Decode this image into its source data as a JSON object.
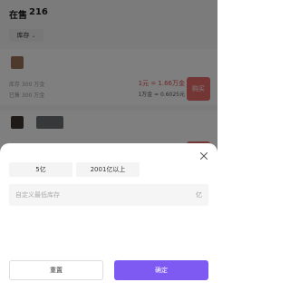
{
  "header": {
    "title_prefix": "在售",
    "title_count": "216"
  },
  "filter": {
    "stock_label": "库存",
    "chevron": "⌄"
  },
  "listing1": {
    "stock_meta": "库存 300 万金",
    "sold_meta": "已售 300 万金",
    "price_line": "1元 = 1.66万金",
    "ratio_line": "1万金 = 0.6025元",
    "buy_label": "购买",
    "swatch_color": "#9b7559"
  },
  "listing2": {
    "swatch_color": "#3c3530",
    "tag_color": "#6c7172"
  },
  "sheet": {
    "close_icon": "close-icon",
    "options": [
      "5亿",
      "2001亿以上"
    ],
    "custom_placeholder": "自定义最低库存",
    "unit": "亿",
    "reset_label": "重置",
    "confirm_label": "确定"
  },
  "colors": {
    "accent": "#7e5af2",
    "price_red": "#e34d4d",
    "buy_button": "#e86a6a"
  }
}
